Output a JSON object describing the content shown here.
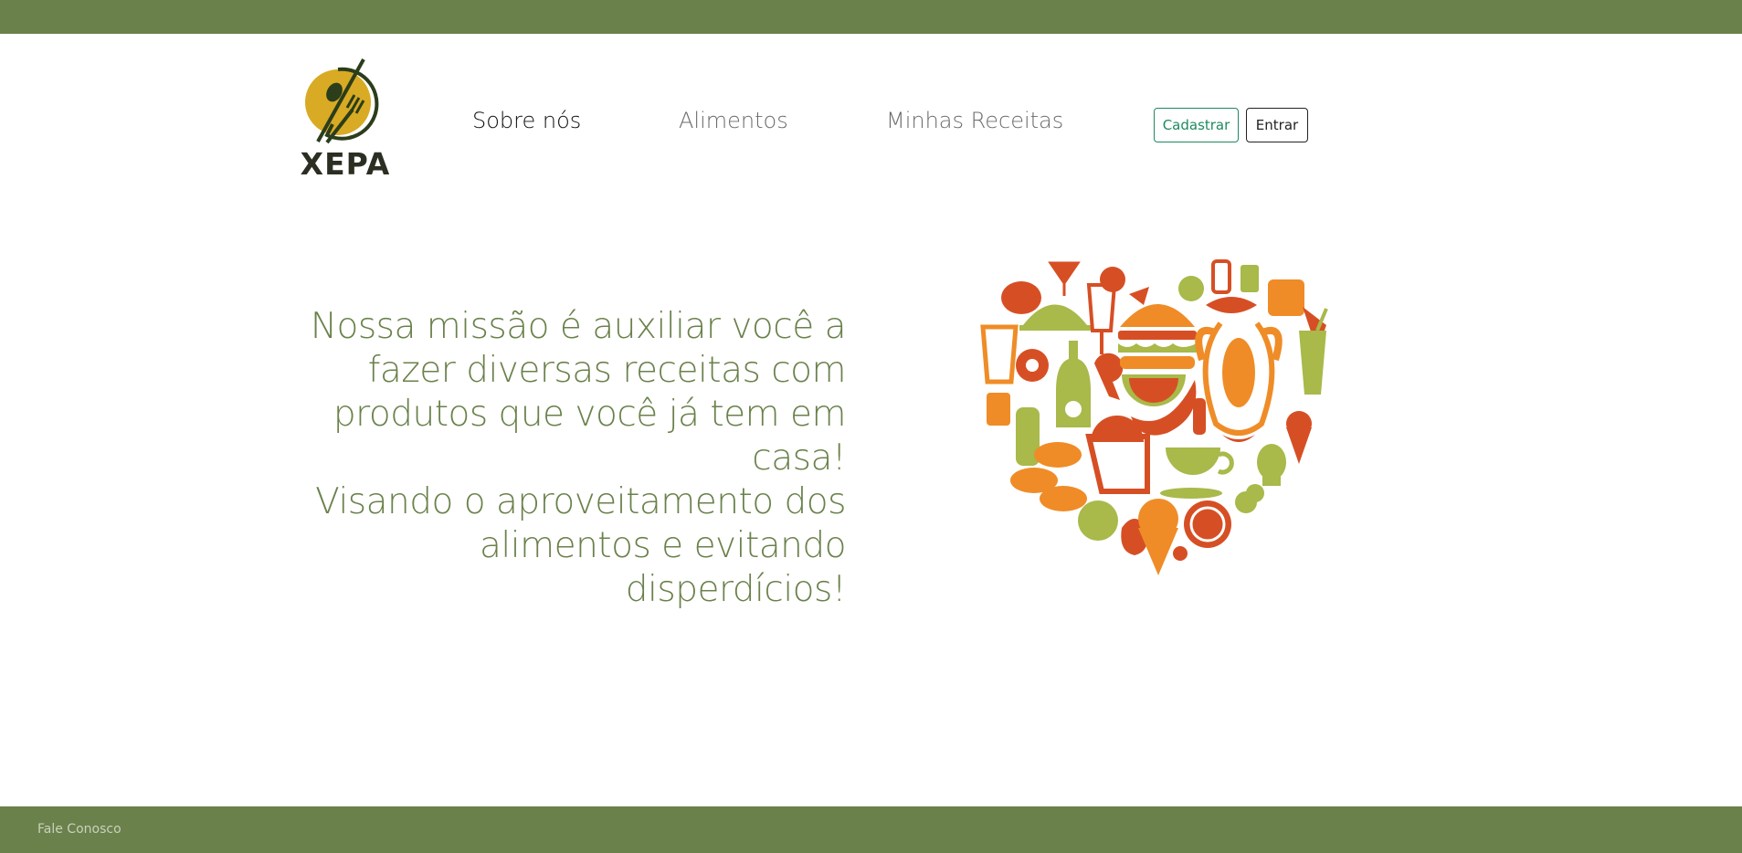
{
  "brand": {
    "name": "XEPA",
    "colors": {
      "primary": "#6a814b",
      "logo_circle": "#d9aa23",
      "logo_dark": "#2b3d1a"
    }
  },
  "nav": {
    "items": [
      {
        "label": "Sobre nós",
        "active": true
      },
      {
        "label": "Alimentos",
        "active": false
      },
      {
        "label": "Minhas Receitas",
        "active": false
      }
    ]
  },
  "auth": {
    "signup_label": "Cadastrar",
    "login_label": "Entrar"
  },
  "hero": {
    "mission_lines": [
      "Nossa missão é auxiliar você a",
      "fazer diversas receitas com",
      "produtos que você já tem em casa!",
      "Visando o aproveitamento dos",
      "alimentos e evitando disperdícios!"
    ],
    "illustration": "food-heart-illustration",
    "illustration_colors": [
      "#d64f24",
      "#ef8c27",
      "#a9b94a"
    ]
  },
  "footer": {
    "contact_label": "Fale Conosco"
  }
}
